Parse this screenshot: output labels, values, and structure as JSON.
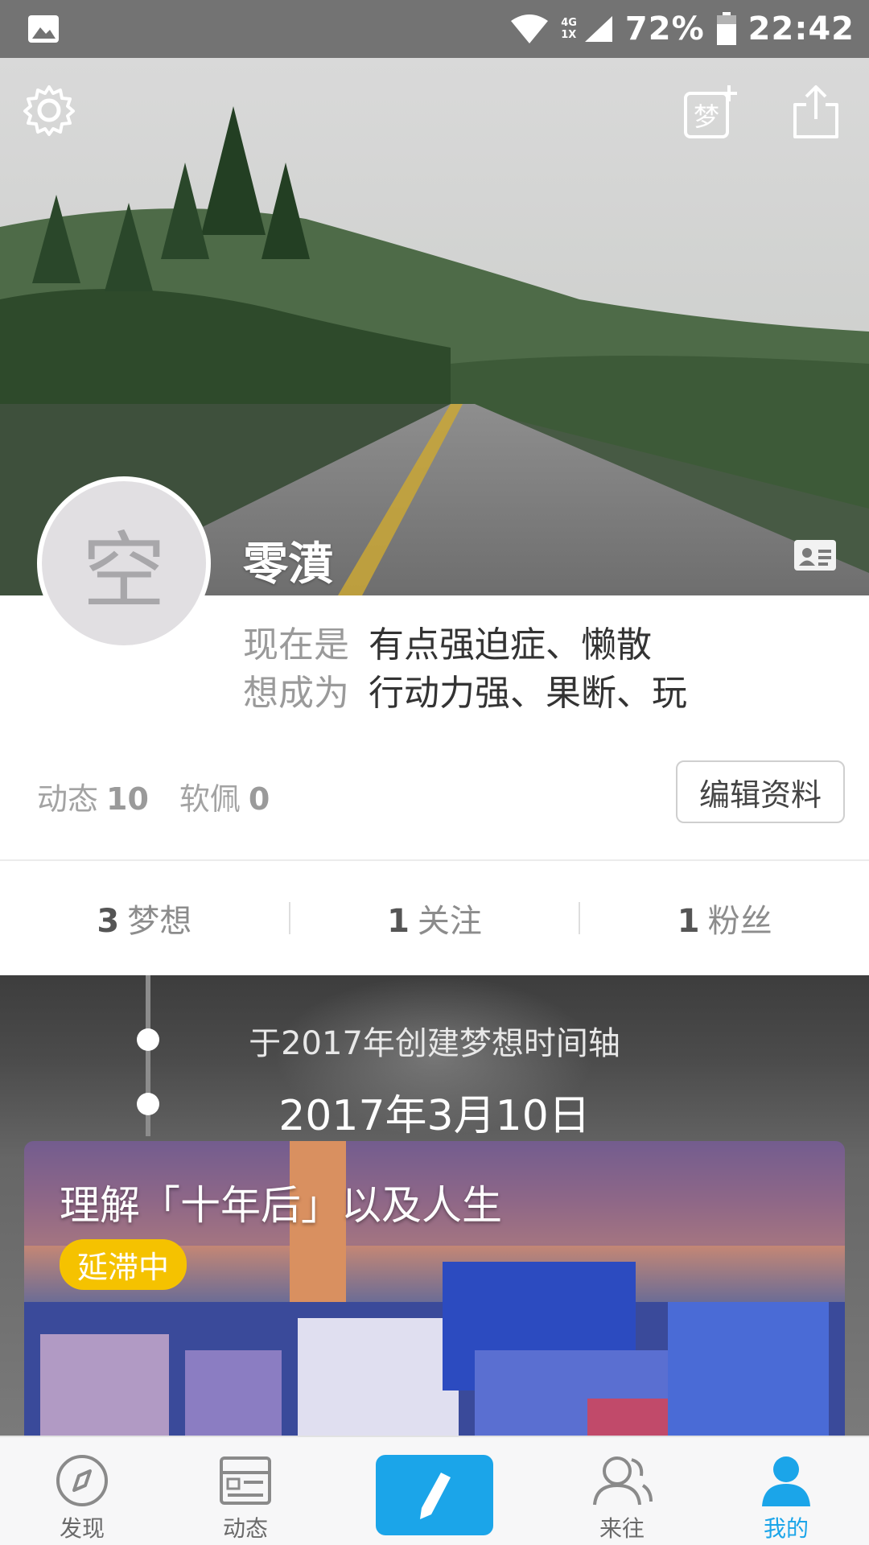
{
  "status_bar": {
    "network_top": "4G",
    "network_bottom": "1X",
    "battery": "72%",
    "time": "22:42"
  },
  "header": {
    "icons": [
      "gear-icon",
      "add-dream-icon",
      "share-icon"
    ],
    "add_dream_glyph": "梦"
  },
  "profile": {
    "avatar_text": "空",
    "username": "零濆",
    "current_label": "现在是",
    "current_value": "有点强迫症、懒散",
    "goal_label": "想成为",
    "goal_value": "行动力强、果断、玩",
    "posts_label": "动态",
    "posts_count": "10",
    "coins_label": "软佩",
    "coins_count": "0",
    "edit_button": "编辑资料"
  },
  "stats": [
    {
      "count": "3",
      "label": "梦想"
    },
    {
      "count": "1",
      "label": "关注"
    },
    {
      "count": "1",
      "label": "粉丝"
    }
  ],
  "timeline": {
    "caption": "于2017年创建梦想时间轴",
    "date": "2017年3月10日",
    "card_title": "理解「十年后」以及人生",
    "card_badge": "延滞中"
  },
  "bottom_nav": [
    {
      "label": "发现",
      "icon": "compass-icon"
    },
    {
      "label": "动态",
      "icon": "feed-icon"
    },
    {
      "label": "",
      "icon": "pencil-icon"
    },
    {
      "label": "来往",
      "icon": "contacts-icon"
    },
    {
      "label": "我的",
      "icon": "profile-icon"
    }
  ],
  "colors": {
    "accent": "#1ba5e9",
    "badge": "#f5c200",
    "status_bar": "#737373"
  }
}
